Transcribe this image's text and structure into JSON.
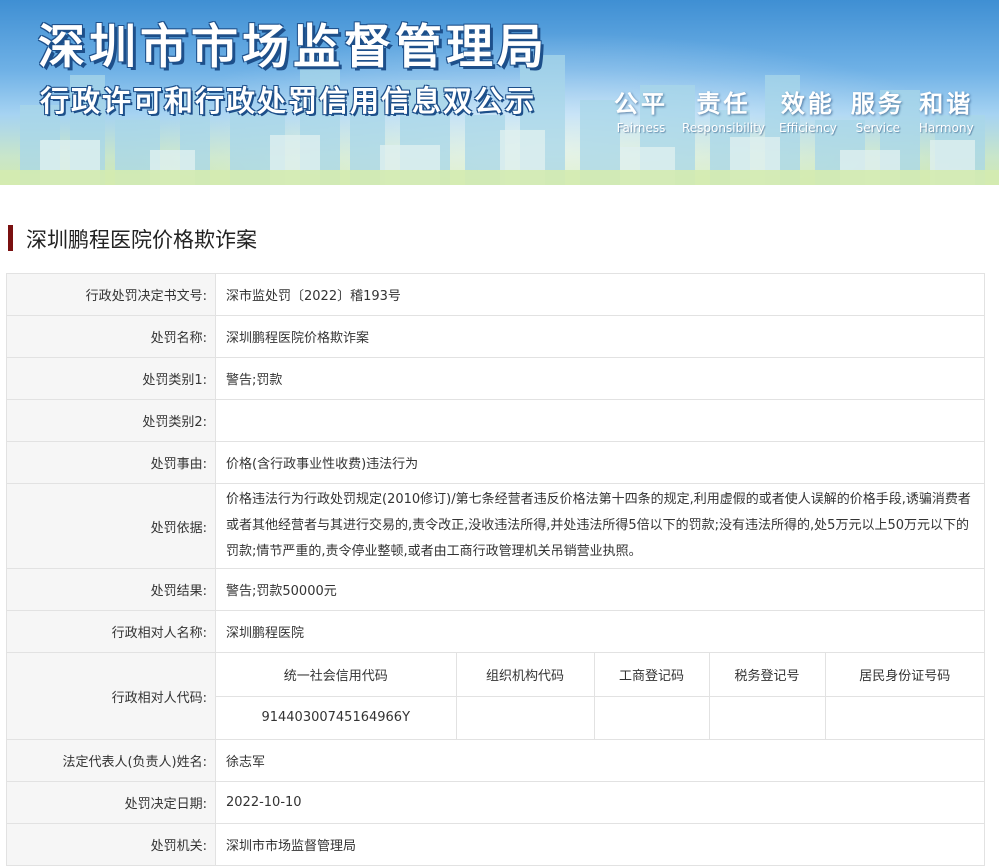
{
  "banner": {
    "title": "深圳市市场监督管理局",
    "subtitle": "行政许可和行政处罚信用信息双公示",
    "values": [
      {
        "cn": "公平",
        "en": "Fairness"
      },
      {
        "cn": "责任",
        "en": "Responsibility"
      },
      {
        "cn": "效能",
        "en": "Efficiency"
      },
      {
        "cn": "服务",
        "en": "Service"
      },
      {
        "cn": "和谐",
        "en": "Harmony"
      }
    ]
  },
  "case_title": "深圳鹏程医院价格欺诈案",
  "accent_color": "#7a1010",
  "rows": {
    "decision_no": {
      "label": "行政处罚决定书文号:",
      "value": "深市监处罚〔2022〕稽193号"
    },
    "penalty_name": {
      "label": "处罚名称:",
      "value": "深圳鹏程医院价格欺诈案"
    },
    "category1": {
      "label": "处罚类别1:",
      "value": "警告;罚款"
    },
    "category2": {
      "label": "处罚类别2:",
      "value": ""
    },
    "reason": {
      "label": "处罚事由:",
      "value": "价格(含行政事业性收费)违法行为"
    },
    "basis": {
      "label": "处罚依据:",
      "value": "价格违法行为行政处罚规定(2010修订)/第七条经营者违反价格法第十四条的规定,利用虚假的或者使人误解的价格手段,诱骗消费者或者其他经营者与其进行交易的,责令改正,没收违法所得,并处违法所得5倍以下的罚款;没有违法所得的,处5万元以上50万元以下的罚款;情节严重的,责令停业整顿,或者由工商行政管理机关吊销营业执照。"
    },
    "result": {
      "label": "处罚结果:",
      "value": "警告;罚款50000元"
    },
    "party_name": {
      "label": "行政相对人名称:",
      "value": "深圳鹏程医院"
    },
    "party_code": {
      "label": "行政相对人代码:",
      "headers": [
        "统一社会信用代码",
        "组织机构代码",
        "工商登记码",
        "税务登记号",
        "居民身份证号码"
      ],
      "values": [
        "91440300745164966Y",
        "",
        "",
        "",
        ""
      ]
    },
    "legal_rep": {
      "label": "法定代表人(负责人)姓名:",
      "value": "徐志军"
    },
    "decision_date": {
      "label": "处罚决定日期:",
      "value": "2022-10-10"
    },
    "authority": {
      "label": "处罚机关:",
      "value": "深圳市市场监督管理局"
    }
  }
}
